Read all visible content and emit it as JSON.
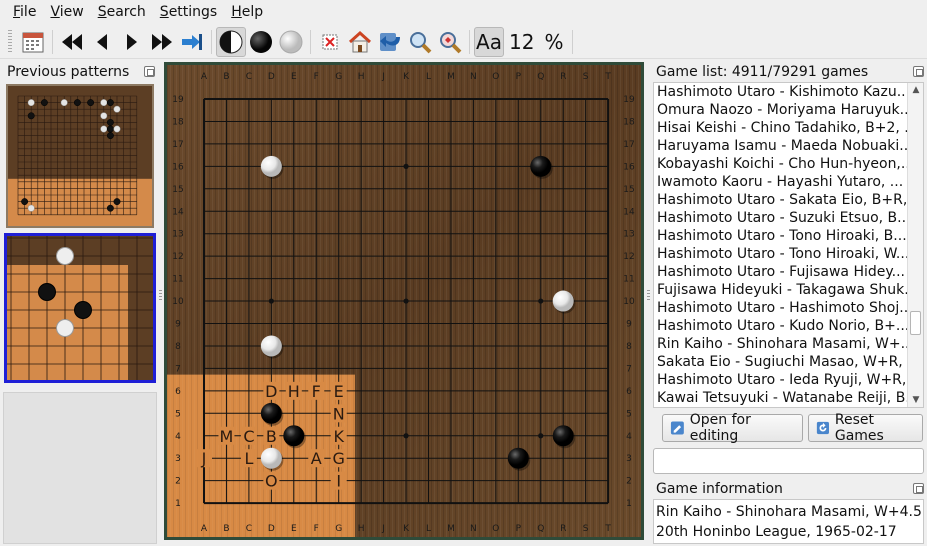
{
  "menu": [
    "File",
    "View",
    "Search",
    "Settings",
    "Help"
  ],
  "toolbar": {
    "font_size": "12",
    "percent": "%",
    "font_label": "Aa"
  },
  "left_dock": {
    "title": "Previous patterns"
  },
  "game_list": {
    "title": "Game list: 4911/79291 games",
    "rows": [
      "Hashimoto Utaro - Kishimoto Kazu...",
      "Omura Naozo - Moriyama Haruyuk...",
      "Hisai Keishi - Chino Tadahiko, B+2, ...",
      "Haruyama Isamu - Maeda Nobuaki...",
      "Kobayashi Koichi - Cho Hun-hyeon,...",
      "Iwamoto Kaoru - Hayashi Yutaro, ...",
      "Hashimoto Utaro - Sakata Eio, B+R,...",
      "Hashimoto Utaro - Suzuki Etsuo, B...",
      "Hashimoto Utaro - Tono Hiroaki, B...",
      "Hashimoto Utaro - Tono Hiroaki, W...",
      "Hashimoto Utaro - Fujisawa Hidey...",
      "Fujisawa Hideyuki - Takagawa Shuk...",
      "Hashimoto Utaro - Hashimoto Shoj...",
      "Hashimoto Utaro - Kudo Norio, B+...",
      "Rin Kaiho - Shinohara Masami, W+...",
      "Sakata Eio - Sugiuchi Masao, W+R, ...",
      "Hashimoto Utaro - Ieda Ryuji, W+R,...",
      "Kawai Tetsuyuki - Watanabe Reiji, B..."
    ]
  },
  "buttons": {
    "open": "Open for editing",
    "reset": "Reset Games"
  },
  "search": {
    "value": "",
    "placeholder": ""
  },
  "game_info": {
    "title": "Game information",
    "lines": [
      "Rin Kaiho - Shinohara Masami, W+4.5",
      "20th Honinbo League, 1965-02-17"
    ]
  },
  "board": {
    "columns": [
      "A",
      "B",
      "C",
      "D",
      "E",
      "F",
      "G",
      "H",
      "J",
      "K",
      "L",
      "M",
      "N",
      "O",
      "P",
      "Q",
      "R",
      "S",
      "T"
    ],
    "rows": [
      "19",
      "18",
      "17",
      "16",
      "15",
      "14",
      "13",
      "12",
      "11",
      "10",
      "9",
      "8",
      "7",
      "6",
      "5",
      "4",
      "3",
      "2",
      "1"
    ],
    "stones": [
      {
        "point": "D16",
        "color": "white"
      },
      {
        "point": "Q16",
        "color": "black"
      },
      {
        "point": "R10",
        "color": "white"
      },
      {
        "point": "D8",
        "color": "white"
      },
      {
        "point": "D5",
        "color": "black"
      },
      {
        "point": "E4",
        "color": "black"
      },
      {
        "point": "D3",
        "color": "white"
      },
      {
        "point": "R4",
        "color": "black"
      },
      {
        "point": "P3",
        "color": "black"
      }
    ],
    "hoshi": [
      "D16",
      "K16",
      "Q16",
      "D10",
      "K10",
      "Q10",
      "D4",
      "K4",
      "Q4"
    ],
    "labels": [
      {
        "point": "D6",
        "text": "D"
      },
      {
        "point": "E6",
        "text": "H"
      },
      {
        "point": "F6",
        "text": "F"
      },
      {
        "point": "G6",
        "text": "E"
      },
      {
        "point": "G5",
        "text": "N"
      },
      {
        "point": "B4",
        "text": "M"
      },
      {
        "point": "C4",
        "text": "C"
      },
      {
        "point": "D4",
        "text": "B"
      },
      {
        "point": "G4",
        "text": "K"
      },
      {
        "point": "A3",
        "text": "J"
      },
      {
        "point": "C3",
        "text": "L"
      },
      {
        "point": "F3",
        "text": "A"
      },
      {
        "point": "G3",
        "text": "G"
      },
      {
        "point": "D2",
        "text": "O"
      },
      {
        "point": "G2",
        "text": "I"
      }
    ],
    "search_region": {
      "from": "A1",
      "to": "G6"
    }
  },
  "thumb1": {
    "stones": [
      {
        "point": "C18",
        "color": "white"
      },
      {
        "point": "E18",
        "color": "black"
      },
      {
        "point": "H18",
        "color": "white"
      },
      {
        "point": "K18",
        "color": "black"
      },
      {
        "point": "M18",
        "color": "black"
      },
      {
        "point": "O18",
        "color": "white"
      },
      {
        "point": "P18",
        "color": "black"
      },
      {
        "point": "Q17",
        "color": "white"
      },
      {
        "point": "C16",
        "color": "black"
      },
      {
        "point": "O16",
        "color": "white"
      },
      {
        "point": "P15",
        "color": "black"
      },
      {
        "point": "O14",
        "color": "white"
      },
      {
        "point": "P14",
        "color": "black"
      },
      {
        "point": "Q14",
        "color": "white"
      },
      {
        "point": "P13",
        "color": "black"
      },
      {
        "point": "B3",
        "color": "black"
      },
      {
        "point": "C2",
        "color": "white"
      },
      {
        "point": "P2",
        "color": "black"
      },
      {
        "point": "Q3",
        "color": "black"
      }
    ]
  },
  "thumb2": {
    "stones": [
      {
        "point": "D7",
        "color": "white"
      },
      {
        "point": "C5",
        "color": "black"
      },
      {
        "point": "E4",
        "color": "black"
      },
      {
        "point": "D3",
        "color": "white"
      }
    ]
  }
}
